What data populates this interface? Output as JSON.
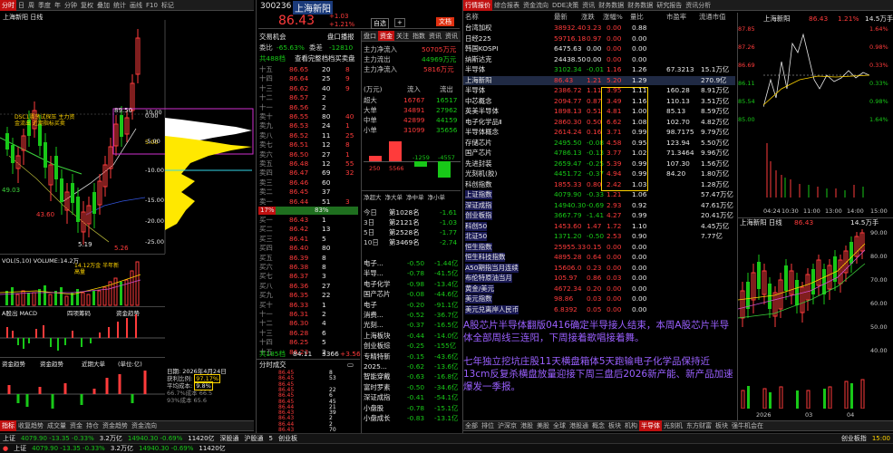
{
  "colors": {
    "up": "#ff3b3b",
    "down": "#18c818",
    "accent": "#c01010",
    "highlight": "#ffd400"
  },
  "left": {
    "tabs": [
      "分时",
      "日",
      "周",
      "季度",
      "年",
      "分钟",
      "5分",
      "15",
      "30",
      "60"
    ],
    "toolbar": [
      "复权",
      "叠加",
      "统计",
      "画线",
      "F10",
      "标记",
      "-",
      "+",
      "🔍"
    ],
    "header": "上海新阳 日线",
    "yticks": [
      "10.00",
      "5.00",
      "0.00",
      "-5.00",
      "-10.00",
      "-15.00",
      "-20.00",
      "-25.00"
    ],
    "markers": {
      "m1": "89.50",
      "m2": "49.03",
      "m3": "43.60",
      "m4": "5.19",
      "m5": "5.26"
    },
    "annot": [
      "DSC1震荡试探压 主力资金流出 近期指标买卖",
      "短线平准",
      "↓",
      "↓",
      "↓"
    ],
    "vol": {
      "label": "VOL(5,10) VOLUME:14.2万",
      "note": "14.12万金 半年新高量"
    },
    "macd": {
      "label": "A股出 MACD",
      "t1": "四项筹码",
      "t2": "资金趋势"
    },
    "chip": {
      "label": "资金趋势",
      "t1": "资金趋势",
      "t2": "近期大单",
      "t3": "(单位:亿)"
    },
    "info": {
      "date": "日期: 2026年4月24日",
      "r1": "获利比例:",
      "v1": "97.17%",
      "r2": "平均成本:",
      "v2": "9.8%",
      "r3": "66.7%成本 66.5",
      "r4": "93%成本 65.6"
    },
    "bottomtabs": [
      "指标",
      "收复趋势",
      "成交量",
      "资金",
      "持仓",
      "资金趋势",
      "资金流向"
    ]
  },
  "mid": {
    "code": "300236",
    "name": "上海新阳",
    "price": "86.43",
    "chg": "+1.03",
    "pct": "+1.21%",
    "btns": [
      "自选",
      "+",
      "文档"
    ],
    "t1": "交易机会",
    "t2": "盘口播报",
    "weibi_l": "委比",
    "weibi_v": "-65.63%",
    "weicha_l": "委差",
    "weicha_v": "-12810",
    "jobs": "共488档",
    "bigorder": "查看完整档档买卖盘",
    "sells": [
      [
        "十五",
        "86.65",
        "20",
        "8"
      ],
      [
        "十四",
        "86.64",
        "25",
        "9"
      ],
      [
        "十三",
        "86.62",
        "40",
        "9"
      ],
      [
        "十二",
        "86.57",
        "2",
        ""
      ],
      [
        "十一",
        "86.56",
        "2",
        ""
      ],
      [
        "卖十",
        "86.55",
        "80",
        "40"
      ],
      [
        "卖九",
        "86.53",
        "24",
        "1"
      ],
      [
        "卖八",
        "86.52",
        "11",
        "25"
      ],
      [
        "卖七",
        "86.51",
        "12",
        "8"
      ],
      [
        "卖六",
        "86.50",
        "27",
        "1"
      ],
      [
        "卖五",
        "86.48",
        "12",
        "55"
      ],
      [
        "卖四",
        "86.47",
        "69",
        "32"
      ],
      [
        "卖三",
        "86.46",
        "60",
        ""
      ],
      [
        "卖二",
        "86.45",
        "37",
        ""
      ],
      [
        "卖一",
        "86.44",
        "51",
        "3"
      ]
    ],
    "buys": [
      [
        "买一",
        "86.43",
        "1",
        ""
      ],
      [
        "买二",
        "86.42",
        "13",
        ""
      ],
      [
        "买三",
        "86.41",
        "5",
        ""
      ],
      [
        "买四",
        "86.40",
        "80",
        ""
      ],
      [
        "买五",
        "86.39",
        "8",
        ""
      ],
      [
        "买六",
        "86.38",
        "8",
        ""
      ],
      [
        "买七",
        "86.37",
        "3",
        ""
      ],
      [
        "买八",
        "86.36",
        "27",
        ""
      ],
      [
        "买九",
        "86.35",
        "22",
        ""
      ],
      [
        "买十",
        "86.33",
        "1",
        ""
      ],
      [
        "十一",
        "86.31",
        "2",
        ""
      ],
      [
        "十二",
        "86.30",
        "4",
        ""
      ],
      [
        "十三",
        "86.28",
        "6",
        ""
      ],
      [
        "十四",
        "86.25",
        "5",
        ""
      ],
      [
        "十五",
        "86.23",
        "2",
        ""
      ]
    ],
    "bar_pct_l": "17%",
    "bar_pct_r": "83%",
    "jobs2": "共185档",
    "last": "84.11",
    "lastv": "3366",
    "lastv2": "+3.56",
    "ticks_title": "分时成交",
    "ticks": [
      [
        "86.45",
        "8"
      ],
      [
        "86.45",
        "53"
      ],
      [
        "86.45",
        "",
        ""
      ],
      [
        "86.45",
        "22"
      ],
      [
        "86.45",
        "6"
      ],
      [
        "86.45",
        "45"
      ],
      [
        "86.44",
        "21"
      ],
      [
        "86.43",
        "39"
      ],
      [
        "86.43",
        "2"
      ],
      [
        "86.44",
        "2"
      ],
      [
        "86.43",
        "70"
      ]
    ],
    "fund": {
      "tabs": [
        "盘口",
        "资金",
        "关注",
        "指数",
        "资讯",
        "资讯"
      ],
      "r1l": "主力净流入",
      "r1v": "50705万元",
      "r2l": "主力流出",
      "r2v": "44969万元",
      "r3l": "主力净流入",
      "r3v": "5816万元",
      "hd": [
        "(万元)",
        "流入",
        "流出"
      ],
      "rows": [
        [
          "超大",
          "16767",
          "16517"
        ],
        [
          "大单",
          "34891",
          "27962"
        ],
        [
          "中单",
          "42899",
          "44159"
        ],
        [
          "小单",
          "31099",
          "35656"
        ]
      ],
      "bars": [
        "250",
        "5566",
        "-1259",
        "-4557"
      ],
      "flowtabs": [
        "净超大",
        "净大单",
        "净中单",
        "净小单"
      ],
      "days": [
        [
          "今日",
          "第1028名",
          "-1.61"
        ],
        [
          "3日",
          "第2121名",
          "-1.03"
        ],
        [
          "5日",
          "第2528名",
          "-1.77"
        ],
        [
          "10日",
          "第3469名",
          "-2.74"
        ]
      ],
      "boards": [
        [
          "电子...",
          "-0.50",
          "-1.44亿"
        ],
        [
          "半导...",
          "-0.78",
          "-41.5亿"
        ],
        [
          "电子化学",
          "-0.98",
          "-13.4亿"
        ],
        [
          "国产芯片",
          "-0.08",
          "-44.6亿"
        ],
        [
          "电子",
          "-0.20",
          "-91.1亿"
        ],
        [
          "消费...",
          "-0.52",
          "-36.7亿"
        ],
        [
          "光刻...",
          "-0.37",
          "-16.5亿"
        ],
        [
          "上海板块",
          "-0.44",
          "-14.0亿"
        ],
        [
          "创业板综",
          "-0.25",
          "-155亿"
        ],
        [
          "专精特新",
          "-0.15",
          "-43.6亿"
        ],
        [
          "2025...",
          "-0.62",
          "-13.6亿"
        ],
        [
          "智能穿戴",
          "-0.63",
          "-16.8亿"
        ],
        [
          "富时罗素",
          "-0.50",
          "-34.6亿"
        ],
        [
          "深证成指",
          "-0.41",
          "-54.1亿"
        ],
        [
          "小盘股",
          "-0.78",
          "-15.1亿"
        ],
        [
          "小盘成长",
          "-0.83",
          "-13.1亿"
        ]
      ]
    }
  },
  "right": {
    "tabs": [
      "行情报价",
      "综合报表",
      "资金流向",
      "DDE决策",
      "资讯",
      "财务数据",
      "财务数据",
      "研究报告",
      "资讯分析"
    ],
    "cols": [
      "名称",
      "最新",
      "涨跌",
      "涨幅%",
      "量比",
      "市盈率",
      "流通市值"
    ],
    "rows": [
      [
        "台湾加权",
        "38932.40",
        "3.23",
        "0.00",
        "0.88",
        "",
        ""
      ],
      [
        "日经225",
        "59716.18",
        "0.97",
        "0.00",
        "0.00",
        "",
        ""
      ],
      [
        "韩国KOSPI",
        "6475.63",
        "0.00",
        "0.00",
        "0.00",
        "",
        ""
      ],
      [
        "纳斯达克",
        "24438.50",
        "0.00",
        "0.00",
        "0.00",
        "",
        ""
      ],
      [
        "半导体",
        "3102.34",
        "-0.01",
        "1.16",
        "1.26",
        "67.3213",
        "15.1万亿"
      ],
      [
        "上海新阳",
        "86.43",
        "1.21",
        "5.20",
        "1.29",
        "",
        "270.9亿"
      ],
      [
        "半导体",
        "2386.72",
        "1.11",
        "3.95",
        "1.11",
        "160.28",
        "8.91万亿"
      ],
      [
        "中芯概念",
        "2094.77",
        "0.87",
        "3.49",
        "1.16",
        "110.13",
        "3.51万亿"
      ],
      [
        "英美半导体",
        "1898.13",
        "0.51",
        "4.81",
        "1.00",
        "85.13",
        "8.59万亿"
      ],
      [
        "电子化学品Ⅱ",
        "2860.30",
        "0.50",
        "6.62",
        "1.08",
        "102.70",
        "4.82万亿"
      ],
      [
        "半导体概念",
        "2614.24",
        "0.16",
        "3.71",
        "0.99",
        "98.7175",
        "9.79万亿"
      ],
      [
        "存储芯片",
        "2495.50",
        "-0.08",
        "4.58",
        "0.95",
        "123.94",
        "5.50万亿"
      ],
      [
        "国产芯片",
        "4786.13",
        "-0.13",
        "3.77",
        "1.02",
        "71.3464",
        "9.96万亿"
      ],
      [
        "先进封装",
        "2659.47",
        "-0.25",
        "5.39",
        "0.99",
        "107.30",
        "1.56万亿"
      ],
      [
        "光刻机(胶)",
        "4451.72",
        "-0.37",
        "4.94",
        "0.99",
        "84.20",
        "1.80万亿"
      ],
      [
        "科创指数",
        "1855.33",
        "0.80",
        "2.42",
        "1.03",
        "",
        "1.28万亿"
      ],
      [
        "上证指数",
        "4079.90",
        "-0.33",
        "1.21",
        "1.06",
        "",
        "57.47万亿"
      ],
      [
        "深证成指",
        "14940.30",
        "-0.69",
        "2.93",
        "0.92",
        "",
        "47.61万亿"
      ],
      [
        "创业板指",
        "3667.79",
        "-1.41",
        "4.27",
        "0.99",
        "",
        "20.41万亿"
      ],
      [
        "科创50",
        "1453.60",
        "1.47",
        "1.72",
        "1.10",
        "",
        "4.45万亿"
      ],
      [
        "北证50",
        "1371.20",
        "-0.50",
        "2.53",
        "0.90",
        "",
        "7.77亿"
      ],
      [
        "恒生指数",
        "25955.33",
        "0.15",
        "0.00",
        "0.00",
        "",
        ""
      ],
      [
        "恒生科技指数",
        "4895.28",
        "0.64",
        "0.00",
        "0.00",
        "",
        ""
      ],
      [
        "A50期指当月连续",
        "15606.0",
        "0.23",
        "0.00",
        "0.00",
        "",
        ""
      ],
      [
        "布伦特原油当月",
        "105.97",
        "0.86",
        "0.03",
        "0.00",
        "",
        ""
      ],
      [
        "黄金/美元",
        "4672.34",
        "0.20",
        "0.00",
        "0.00",
        "",
        ""
      ],
      [
        "美元指数",
        "98.86",
        "0.03",
        "0.00",
        "0.00",
        "",
        ""
      ],
      [
        "美元兑离岸人民币",
        "6.8392",
        "0.05",
        "0.00",
        "0.00",
        "",
        ""
      ]
    ],
    "news1": "A股芯片半导体翻版0416确定半导接人结束，本周A股芯片半导体全部周线三连阳，下周接着歌唱接着舞。",
    "news2": "七年独立挖坑庄股11天横盘箱体5天跑输电子化学品保持近13cm反复杀横盘放量迎接下周三盘后2026新产能、新产品加速爆发一季报。",
    "mini1": {
      "title": "上海新阳",
      "price": "86.43",
      "pct": "1.21%",
      "mv": "14.5万手",
      "y": [
        "87.85",
        "87.26",
        "86.69",
        "86.11",
        "85.54",
        "85.00"
      ],
      "yr": [
        "1.64%",
        "0.98%",
        "0.33%",
        "0.33%",
        "0.98%",
        "1.64%"
      ],
      "x": [
        "04:24",
        "10:30",
        "11:00",
        "13:00",
        "14:00",
        "15:00"
      ]
    },
    "mini2": {
      "title": "上海新阳 日线",
      "price": "86.43",
      "vol": "14.5万手",
      "y": [
        "90.00",
        "80.00",
        "70.00",
        "60.00",
        "50.00",
        "40.00"
      ],
      "x": [
        "2026",
        "03",
        "04"
      ]
    },
    "bottomtabs": [
      "全部",
      "排位",
      "沪深京",
      "港股",
      "美股",
      "全球",
      "港股通",
      "概念",
      "板块",
      "机构",
      "半导体",
      "光刻机",
      "东方财富",
      "板块",
      "强牛机会在"
    ]
  },
  "status": {
    "items": [
      "上证",
      "4079.90 -13.35 -0.33%",
      "3.2万亿",
      "14940.30 -0.69%",
      "11420亿",
      "深股通",
      "沪股通",
      "5",
      "创业板"
    ],
    "rt": "创业板指",
    "clock": "15:00"
  }
}
